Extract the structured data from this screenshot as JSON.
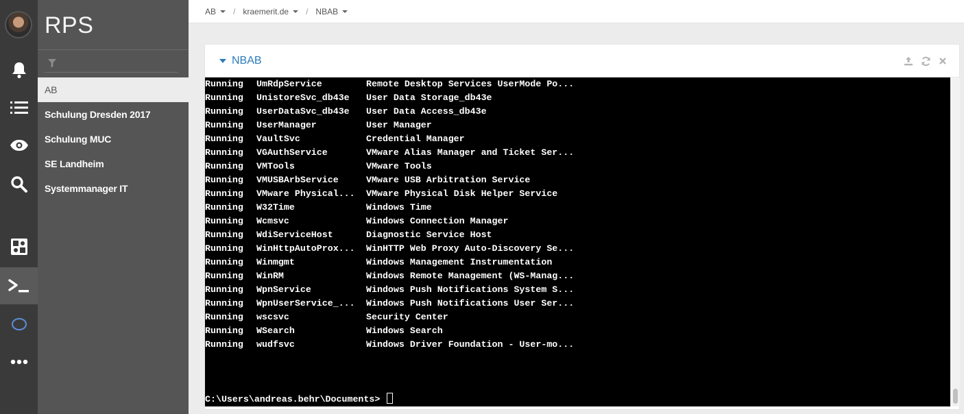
{
  "app": {
    "brand": "RPS"
  },
  "rail": {
    "icons": [
      "avatar",
      "bell-icon",
      "list-icon",
      "eye-icon",
      "search-icon",
      "puzzle-icon",
      "terminal-icon",
      "ring-icon",
      "more-icon"
    ],
    "active": "terminal-icon"
  },
  "sidebar": {
    "filter_placeholder": "",
    "items": [
      {
        "label": "AB",
        "selected": true
      },
      {
        "label": "Schulung Dresden 2017"
      },
      {
        "label": "Schulung MUC"
      },
      {
        "label": "SE Landheim"
      },
      {
        "label": "Systemmanager IT"
      }
    ]
  },
  "breadcrumb": [
    "AB",
    "kraemerit.de",
    "NBAB"
  ],
  "panel": {
    "title": "NBAB"
  },
  "terminal": {
    "rows": [
      [
        "Running",
        "UmRdpService",
        "Remote Desktop Services UserMode Po..."
      ],
      [
        "Running",
        "UnistoreSvc_db43e",
        "User Data Storage_db43e"
      ],
      [
        "Running",
        "UserDataSvc_db43e",
        "User Data Access_db43e"
      ],
      [
        "Running",
        "UserManager",
        "User Manager"
      ],
      [
        "Running",
        "VaultSvc",
        "Credential Manager"
      ],
      [
        "Running",
        "VGAuthService",
        "VMware Alias Manager and Ticket Ser..."
      ],
      [
        "Running",
        "VMTools",
        "VMware Tools"
      ],
      [
        "Running",
        "VMUSBArbService",
        "VMware USB Arbitration Service"
      ],
      [
        "Running",
        "VMware Physical...",
        "VMware Physical Disk Helper Service"
      ],
      [
        "Running",
        "W32Time",
        "Windows Time"
      ],
      [
        "Running",
        "Wcmsvc",
        "Windows Connection Manager"
      ],
      [
        "Running",
        "WdiServiceHost",
        "Diagnostic Service Host"
      ],
      [
        "Running",
        "WinHttpAutoProx...",
        "WinHTTP Web Proxy Auto-Discovery Se..."
      ],
      [
        "Running",
        "Winmgmt",
        "Windows Management Instrumentation"
      ],
      [
        "Running",
        "WinRM",
        "Windows Remote Management (WS-Manag..."
      ],
      [
        "Running",
        "WpnService",
        "Windows Push Notifications System S..."
      ],
      [
        "Running",
        "WpnUserService_...",
        "Windows Push Notifications User Ser..."
      ],
      [
        "Running",
        "wscsvc",
        "Security Center"
      ],
      [
        "Running",
        "WSearch",
        "Windows Search"
      ],
      [
        "Running",
        "wudfsvc",
        "Windows Driver Foundation - User-mo..."
      ]
    ],
    "prompt": "C:\\Users\\andreas.behr\\Documents> "
  },
  "colors": {
    "rail": "#3a3a3a",
    "sidebar": "#555555",
    "accent": "#2b7bb9",
    "terminal_bg": "#000000"
  }
}
